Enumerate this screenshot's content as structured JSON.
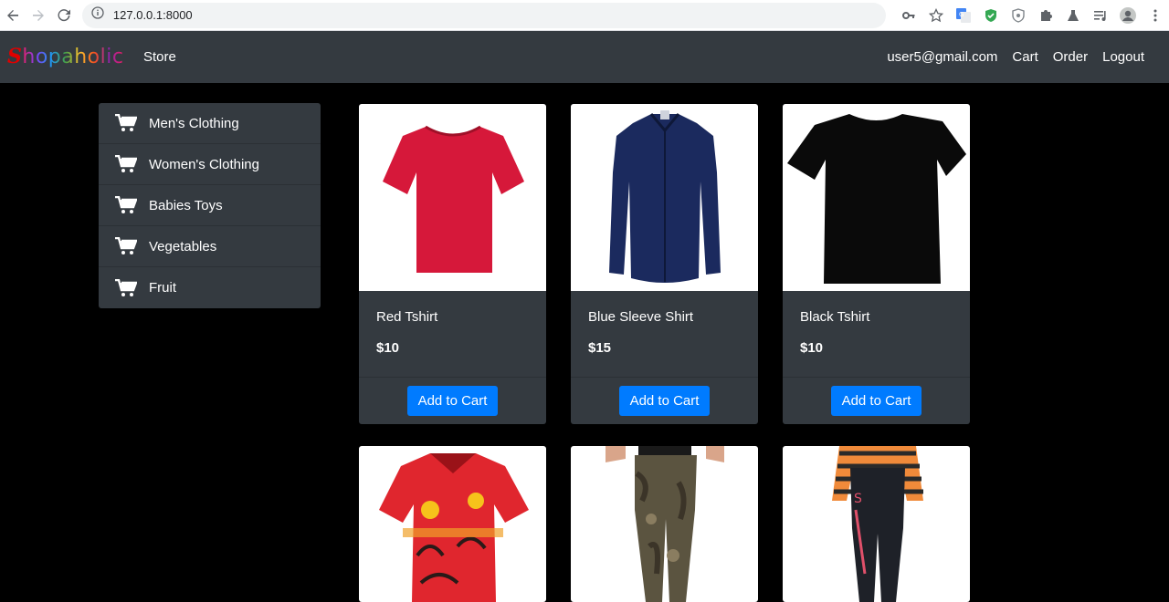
{
  "browser": {
    "url": "127.0.0.1:8000"
  },
  "navbar": {
    "brand_first": "S",
    "brand_rest": "hopaholic",
    "store": "Store",
    "user": "user5@gmail.com",
    "cart": "Cart",
    "order": "Order",
    "logout": "Logout"
  },
  "sidebar": {
    "items": [
      {
        "label": "Men's Clothing"
      },
      {
        "label": "Women's Clothing"
      },
      {
        "label": "Babies Toys"
      },
      {
        "label": "Vegetables"
      },
      {
        "label": "Fruit"
      }
    ]
  },
  "products": [
    {
      "name": "Red Tshirt",
      "price": "$10",
      "button": "Add to Cart",
      "color": "#d6183a"
    },
    {
      "name": "Blue Sleeve Shirt",
      "price": "$15",
      "button": "Add to Cart",
      "color": "#1b2a5e"
    },
    {
      "name": "Black Tshirt",
      "price": "$10",
      "button": "Add to Cart",
      "color": "#0a0a0a"
    }
  ]
}
